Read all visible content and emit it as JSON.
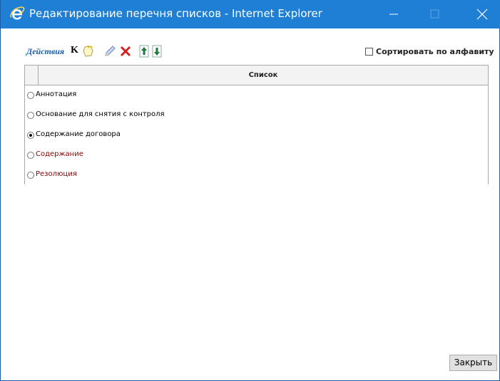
{
  "window": {
    "title": "Редактирование перечня списков - Internet Explorer",
    "accent_color": "#1e7fd5"
  },
  "toolbar": {
    "actions_label": "Действия",
    "k_label": "K",
    "icons": [
      "new-note-icon",
      "edit-pencil-icon",
      "delete-x-icon",
      "move-up-icon",
      "move-down-icon"
    ]
  },
  "sort": {
    "label": "Сортировать по алфавиту",
    "checked": false
  },
  "table": {
    "header": "Список",
    "rows": [
      {
        "label": "Аннотация",
        "selected": false,
        "color": "#000000"
      },
      {
        "label": "Основание для снятия с контроля",
        "selected": false,
        "color": "#000000"
      },
      {
        "label": "Содержание договора",
        "selected": true,
        "color": "#000000"
      },
      {
        "label": "Содержание",
        "selected": false,
        "color": "#8b0000"
      },
      {
        "label": "Резолюция",
        "selected": false,
        "color": "#8b0000"
      }
    ]
  },
  "footer": {
    "close_label": "Закрыть"
  }
}
